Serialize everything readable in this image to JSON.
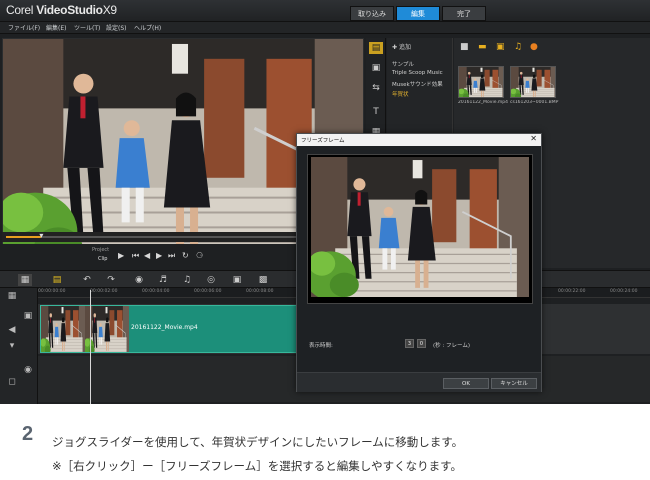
{
  "app": {
    "title_light": "Corel",
    "title_bold": "VideoStudio",
    "title_version": "X9",
    "mode_tabs": [
      "取り込み",
      "編集",
      "完了"
    ],
    "active_mode": "編集"
  },
  "menu": [
    "ファイル(F)",
    "編集(E)",
    "ツール(T)",
    "設定(S)",
    "ヘルプ(H)"
  ],
  "transport": {
    "project_label": "Project",
    "clip_label": "Clip",
    "scrub_position": 0.1
  },
  "library": {
    "add_label": "追加",
    "folders": [
      "サンプル",
      "Triple Scoop Music",
      "Musekサウンド効果",
      "年賀状"
    ],
    "active_folder": "年賀状",
    "thumbnails": [
      "20161122_Movie.mp4",
      "cs161203~0001.BMP"
    ]
  },
  "timeline": {
    "ruler": [
      "00:00:00:00",
      "00:00:02:00",
      "00:00:04:00",
      "00:00:06:00",
      "00:00:08:00",
      "00:00:10:00",
      "00:00:12:00",
      "00:00:14:00",
      "00:00:16:00",
      "00:00:20:00",
      "00:00:22:00",
      "00:00:24:00"
    ],
    "clip_name": "20161122_Movie.mp4"
  },
  "dialog": {
    "title": "フリーズフレーム",
    "duration_label": "表示時間:",
    "duration_value": "3",
    "frame_value": "0",
    "unit_label": "(秒 : フレーム)",
    "ok_label": "OK",
    "cancel_label": "キャンセル"
  },
  "caption": {
    "step_number": "2",
    "text": "ジョグスライダーを使用して、年賀状デザインにしたいフレームに移動します。",
    "note": "※［右クリック］ー［フリーズフレーム］を選択すると編集しやすくなります。"
  },
  "colors": {
    "accent_blue": "#1f8bd8",
    "clip_green": "#1c8f7a",
    "folder_highlight": "#e0b030"
  }
}
